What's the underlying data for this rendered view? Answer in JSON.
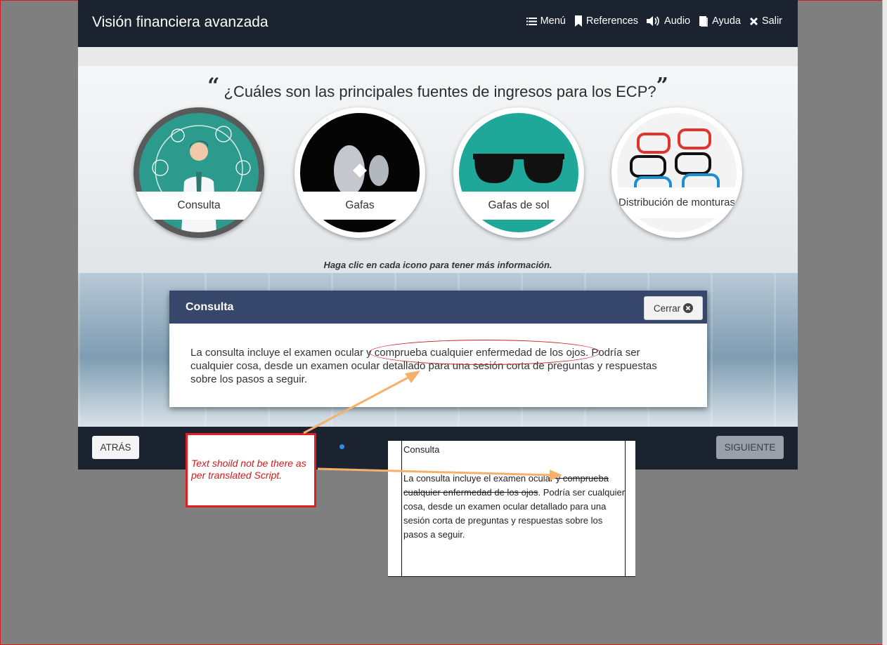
{
  "app": {
    "title": "Visión financiera avanzada",
    "nav": [
      {
        "label": "Menú",
        "icon": "menu-icon"
      },
      {
        "label": "References",
        "icon": "bookmark-icon"
      },
      {
        "label": "Audio",
        "icon": "speaker-icon"
      },
      {
        "label": "Ayuda",
        "icon": "book-icon"
      },
      {
        "label": "Salir",
        "icon": "close-icon"
      }
    ]
  },
  "slide": {
    "question": "¿Cuáles son las principales fuentes de ingresos para los ECP?",
    "quote_open": "“",
    "quote_close": "”",
    "options": [
      {
        "label": "Consulta",
        "active": true
      },
      {
        "label": "Gafas",
        "active": false
      },
      {
        "label": "Gafas de sol",
        "active": false
      },
      {
        "label": "Distribución de monturas",
        "active": false
      }
    ],
    "hint": "Haga clic en cada icono para tener más información."
  },
  "popup": {
    "title": "Consulta",
    "close_label": "Cerrar",
    "body": "La consulta incluye el examen ocular y comprueba cualquier enfermedad de los ojos. Podría ser cualquier cosa, desde un examen ocular detallado para una sesión corta de preguntas y respuestas sobre los pasos a seguir."
  },
  "footer": {
    "back_label": "ATRÁS",
    "next_label": "SIGUIENTE"
  },
  "annotation": {
    "note": "Text shoild not be there as per translated Script.",
    "script_title": "Consulta",
    "script_text_plain_1": "La consulta incluye el examen ocular",
    "script_text_struck": " y comprueba cualquier enfermedad de los ojos",
    "script_text_plain_2": ". Podría ser cualquier cosa, desde un examen ocular detallado para una sesión corta de preguntas y respuestas sobre los pasos a seguir.",
    "colors": {
      "note_border": "#e02020",
      "arrow": "#f5b06a",
      "highlight": "#c9202a"
    }
  }
}
